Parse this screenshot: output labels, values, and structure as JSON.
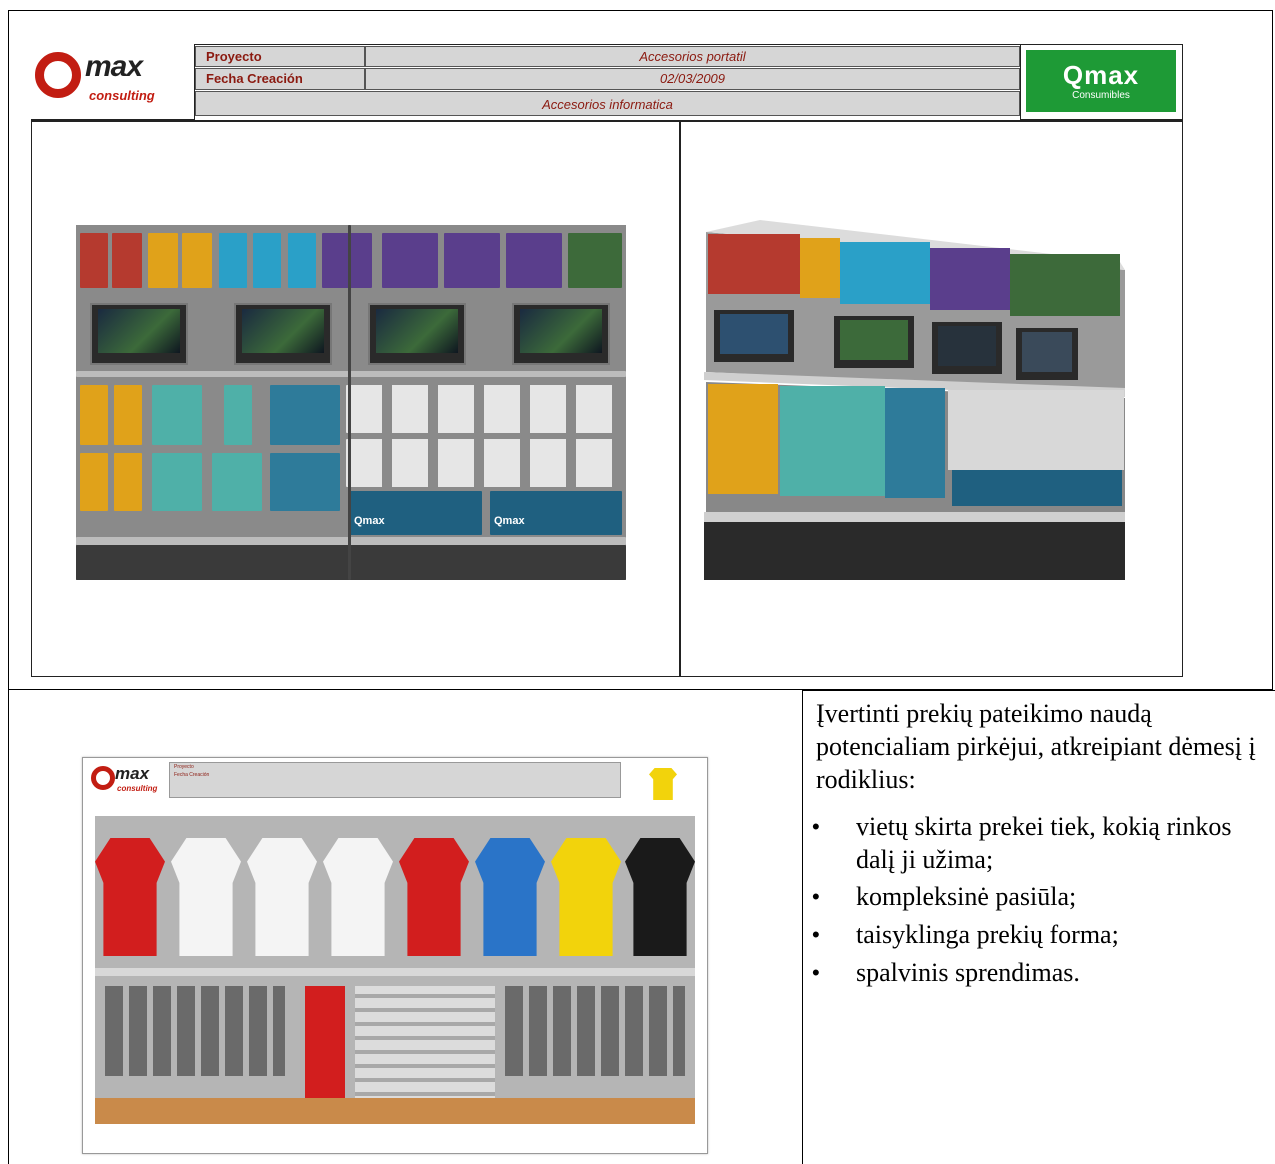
{
  "header": {
    "proyecto_label": "Proyecto",
    "proyecto_value": "Accesorios portatil",
    "fecha_label": "Fecha Creación",
    "fecha_value": "02/03/2009",
    "category": "Accesorios informatica"
  },
  "logo": {
    "text": "max",
    "sub": "consulting"
  },
  "brand": {
    "word": "Qmax",
    "sub": "Consumibles",
    "color": "#1e9a36"
  },
  "planogram_brand_label": "Qmax",
  "apparel_sheet": {
    "proyecto_label": "Proyecto",
    "fecha_label": "Fecha Creación"
  },
  "text_block": {
    "intro": "Įvertinti prekių pateikimo naudą potencialiam pirkėjui, atkreipiant dėmesį į rodiklius:",
    "bullets": [
      "vietų skirta prekei tiek, kokią rinkos dalį ji užima;",
      "kompleksinė pasiūla;",
      "taisyklinga prekių forma;",
      "spalvinis sprendimas."
    ]
  }
}
